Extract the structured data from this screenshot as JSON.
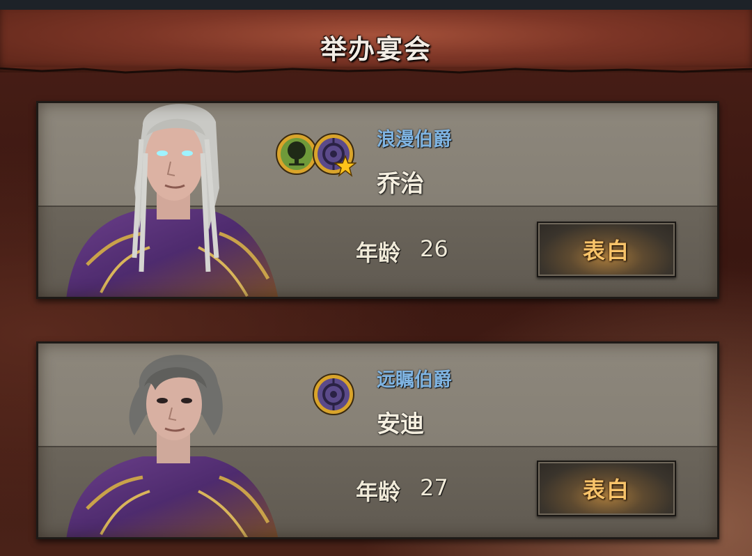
{
  "header": {
    "title": "举办宴会"
  },
  "suitors": [
    {
      "rank_title": "浪漫伯爵",
      "name": "乔治",
      "age_label": "年龄",
      "age": "26",
      "action_label": "表白",
      "badges": [
        "tree-emblem-icon",
        "eye-sigil-icon",
        "star-icon"
      ],
      "hair_color": "#c9c9c5"
    },
    {
      "rank_title": "远瞩伯爵",
      "name": "安迪",
      "age_label": "年龄",
      "age": "27",
      "action_label": "表白",
      "badges": [
        "eye-sigil-icon"
      ],
      "hair_color": "#6f6f6c"
    }
  ],
  "colors": {
    "rank_title": "#7fb4e2",
    "action_text": "#f7c36a",
    "header_bg": "#7c3526",
    "card_bg": "#878176"
  }
}
